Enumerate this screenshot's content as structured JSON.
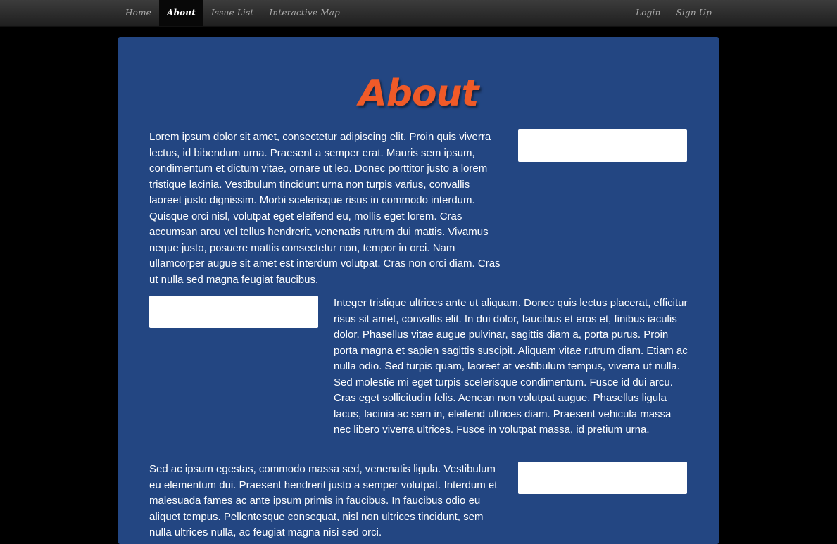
{
  "nav": {
    "left": [
      {
        "label": "Home",
        "active": false
      },
      {
        "label": "About",
        "active": true
      },
      {
        "label": "Issue List",
        "active": false
      },
      {
        "label": "Interactive Map",
        "active": false
      }
    ],
    "right": [
      {
        "label": "Login"
      },
      {
        "label": "Sign Up"
      }
    ]
  },
  "page": {
    "title": "About",
    "title_color": "#f05a28",
    "panel_color": "#234682",
    "paragraphs": [
      "Lorem ipsum dolor sit amet, consectetur adipiscing elit. Proin quis viverra lectus, id bibendum urna. Praesent a semper erat. Mauris sem ipsum, condimentum et dictum vitae, ornare ut leo. Donec porttitor justo a lorem tristique lacinia. Vestibulum tincidunt urna non turpis varius, convallis laoreet justo dignissim. Morbi scelerisque risus in commodo interdum. Quisque orci nisl, volutpat eget eleifend eu, mollis eget lorem. Cras accumsan arcu vel tellus hendrerit, venenatis rutrum dui mattis. Vivamus neque justo, posuere mattis consectetur non, tempor in orci. Nam ullamcorper augue sit amet est interdum volutpat. Cras non orci diam. Cras ut nulla sed magna feugiat faucibus.",
      "Integer tristique ultrices ante ut aliquam. Donec quis lectus placerat, efficitur risus sit amet, convallis elit. In dui dolor, faucibus et eros et, finibus iaculis dolor. Phasellus vitae augue pulvinar, sagittis diam a, porta purus. Proin porta magna et sapien sagittis suscipit. Aliquam vitae rutrum diam. Etiam ac nulla odio. Sed turpis quam, laoreet at vestibulum tempus, viverra ut nulla. Sed molestie mi eget turpis scelerisque condimentum. Fusce id dui arcu. Cras eget sollicitudin felis. Aenean non volutpat augue. Phasellus ligula lacus, lacinia ac sem in, eleifend ultrices diam. Praesent vehicula massa nec libero viverra ultrices. Fusce in volutpat massa, id pretium urna.",
      "Sed ac ipsum egestas, commodo massa sed, venenatis ligula. Vestibulum eu elementum dui. Praesent hendrerit justo a semper volutpat. Interdum et malesuada fames ac ante ipsum primis in faucibus. In faucibus odio eu aliquet tempus. Pellentesque consequat, nisl non ultrices tincidunt, sem nulla ultrices nulla, ac feugiat magna nisi sed orci."
    ]
  }
}
